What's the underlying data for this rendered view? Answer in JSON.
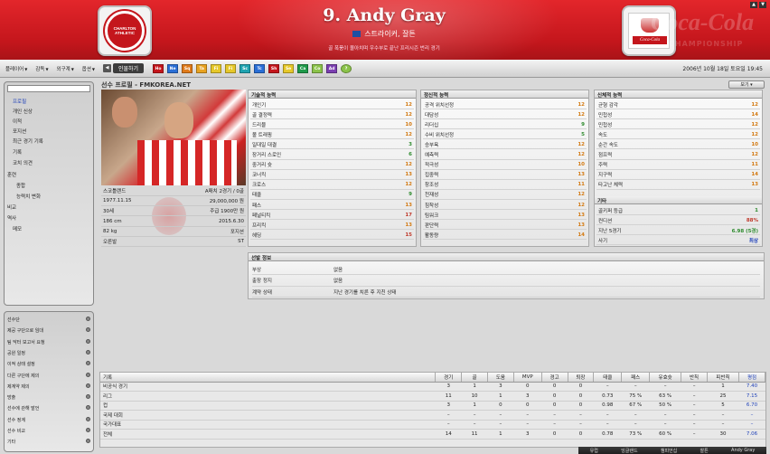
{
  "header": {
    "club_name": "CHARLTON ATHLETIC",
    "player_title": "9. Andy Gray",
    "position_line": "스트라이커, 잘튼",
    "tagline": "골 폭풍이 몰아치며 우수부로 끝난 프리시즌 번리 경기",
    "competition_logo_text": "Coca-Cola",
    "watermark": "Coca-Cola",
    "watermark2": "CHAMPIONSHIP",
    "window_controls": [
      "▲",
      "▼"
    ]
  },
  "menubar": {
    "items": [
      "플레이어",
      "감독",
      "외구계",
      "옵션"
    ],
    "current_tab": "인물하기",
    "attr_buttons": [
      {
        "label": "Ho",
        "color": "#c4161c"
      },
      {
        "label": "Ne",
        "color": "#2a6fd6"
      },
      {
        "label": "Sq",
        "color": "#e07b1a"
      },
      {
        "label": "Ta",
        "color": "#e8a321"
      },
      {
        "label": "Fi",
        "color": "#e6c82a"
      },
      {
        "label": "Fi",
        "color": "#e6c82a"
      },
      {
        "label": "Sc",
        "color": "#1fa3b0"
      },
      {
        "label": "Tc",
        "color": "#2a6fd6"
      },
      {
        "label": "Sh",
        "color": "#c4161c"
      },
      {
        "label": "Se",
        "color": "#e6c82a"
      },
      {
        "label": "Ca",
        "color": "#1f9a4a"
      },
      {
        "label": "Co",
        "color": "#8bc34a"
      },
      {
        "label": "Ad",
        "color": "#7b3fb0"
      }
    ],
    "datetime": "2006년 10월 18일 토요일 19:45"
  },
  "sidebar": {
    "links": [
      "프로필",
      "개인 신상",
      "이적",
      "포지션",
      "최근 경기 기록",
      "기록",
      "코치 의견",
      "훈련",
      "종합",
      "능력치 변화",
      "비교",
      "역사",
      "메모"
    ],
    "actions": [
      "선수단",
      "제공 구단으로 임대",
      "팀 닥터 보고서 요청",
      "공원 일정",
      "이적 상태 설정",
      "다른 구단에 제의",
      "제계약 제의",
      "방출",
      "선수에 관해 발언",
      "선수 정계",
      "선수 비교",
      "기타"
    ]
  },
  "main": {
    "title": "선수 프로필 - FMKOREA.NET",
    "view_button": "보기 ▾",
    "info": [
      {
        "left": "스코틀랜드",
        "right": "A매치 2경기 / 0골"
      },
      {
        "left": "1977.11.15",
        "right": "29,000,000 원"
      },
      {
        "left": "30세",
        "right": "주급 1900만 원"
      },
      {
        "left": "186 cm",
        "right": "2015.6.30"
      },
      {
        "left": "82 kg",
        "right": "포지션"
      },
      {
        "left": "오른발",
        "right": "ST"
      }
    ]
  },
  "panels": {
    "technical": {
      "title": "기술적 능력",
      "rows": [
        {
          "label": "개인기",
          "value": "12"
        },
        {
          "label": "골 결정력",
          "value": "12"
        },
        {
          "label": "드리블",
          "value": "10"
        },
        {
          "label": "볼 트래핑",
          "value": "12"
        },
        {
          "label": "일대일 대결",
          "value": "3"
        },
        {
          "label": "장거리 스로인",
          "value": "6"
        },
        {
          "label": "중거리 슛",
          "value": "12"
        },
        {
          "label": "코너킥",
          "value": "13"
        },
        {
          "label": "크로스",
          "value": "12"
        },
        {
          "label": "태클",
          "value": "9"
        },
        {
          "label": "패스",
          "value": "13"
        },
        {
          "label": "페널티킥",
          "value": "17"
        },
        {
          "label": "프리킥",
          "value": "13"
        },
        {
          "label": "헤딩",
          "value": "15"
        }
      ]
    },
    "mental": {
      "title": "정신적 능력",
      "rows": [
        {
          "label": "공격 위치선정",
          "value": "12"
        },
        {
          "label": "대담성",
          "value": "12"
        },
        {
          "label": "리더십",
          "value": "9"
        },
        {
          "label": "수비 위치선정",
          "value": "5"
        },
        {
          "label": "승부욕",
          "value": "12"
        },
        {
          "label": "예측력",
          "value": "12"
        },
        {
          "label": "적극성",
          "value": "10"
        },
        {
          "label": "집중력",
          "value": "13"
        },
        {
          "label": "창조성",
          "value": "11"
        },
        {
          "label": "천재성",
          "value": "12"
        },
        {
          "label": "침착성",
          "value": "12"
        },
        {
          "label": "팀워크",
          "value": "13"
        },
        {
          "label": "판단력",
          "value": "13"
        },
        {
          "label": "활동량",
          "value": "14"
        }
      ]
    },
    "physical": {
      "title": "신체적 능력",
      "rows": [
        {
          "label": "균형 감각",
          "value": "12"
        },
        {
          "label": "민첩성",
          "value": "14"
        },
        {
          "label": "민첩성",
          "value": "12"
        },
        {
          "label": "속도",
          "value": "12"
        },
        {
          "label": "순간 속도",
          "value": "10"
        },
        {
          "label": "점프력",
          "value": "12"
        },
        {
          "label": "주력",
          "value": "11"
        },
        {
          "label": "지구력",
          "value": "14"
        },
        {
          "label": "타고난 체력",
          "value": "13"
        }
      ],
      "extra_title": "기타",
      "extra_rows": [
        {
          "label": "골키퍼 등급",
          "value": "1"
        },
        {
          "label": "컨디션",
          "value": "88%"
        },
        {
          "label": "지난 5경기",
          "value": "6.98 (5경)"
        },
        {
          "label": "사기",
          "value": "최상"
        }
      ]
    }
  },
  "status": {
    "title": "선발 정보",
    "rows": [
      {
        "label": "부상",
        "value": "없음"
      },
      {
        "label": "출장 정지",
        "value": "없음"
      },
      {
        "label": "계약 상태",
        "value": "지난 경기를 치른 후 지친 상태"
      }
    ]
  },
  "stats": {
    "headers": [
      "기록",
      "경기",
      "골",
      "도움",
      "MVP",
      "경고",
      "퇴장",
      "태클",
      "패스",
      "유효슛",
      "반칙",
      "피반칙",
      "평점"
    ],
    "rows": [
      [
        "비공식 경기",
        "3",
        "1",
        "3",
        "0",
        "0",
        "0",
        "–",
        "–",
        "–",
        "–",
        "1",
        "7.40"
      ],
      [
        "리그",
        "11",
        "10",
        "1",
        "3",
        "0",
        "0",
        "0.73",
        "75 %",
        "63 %",
        "–",
        "25",
        "7.15"
      ],
      [
        "컵",
        "3",
        "1",
        "0",
        "0",
        "0",
        "0",
        "0.98",
        "67 %",
        "50 %",
        "–",
        "5",
        "6.70"
      ],
      [
        "국제 대회",
        "–",
        "–",
        "–",
        "–",
        "–",
        "–",
        "–",
        "–",
        "–",
        "–",
        "–",
        "–"
      ],
      [
        "국가대표",
        "–",
        "–",
        "–",
        "–",
        "–",
        "–",
        "–",
        "–",
        "–",
        "–",
        "–",
        "–"
      ],
      [
        "전체",
        "14",
        "11",
        "1",
        "3",
        "0",
        "0",
        "0.78",
        "73 %",
        "60 %",
        "–",
        "30",
        "7.06"
      ]
    ]
  },
  "footer": [
    "유럽",
    "잉글랜드",
    "챔피언십",
    "찰튼",
    "Andy Gray"
  ]
}
